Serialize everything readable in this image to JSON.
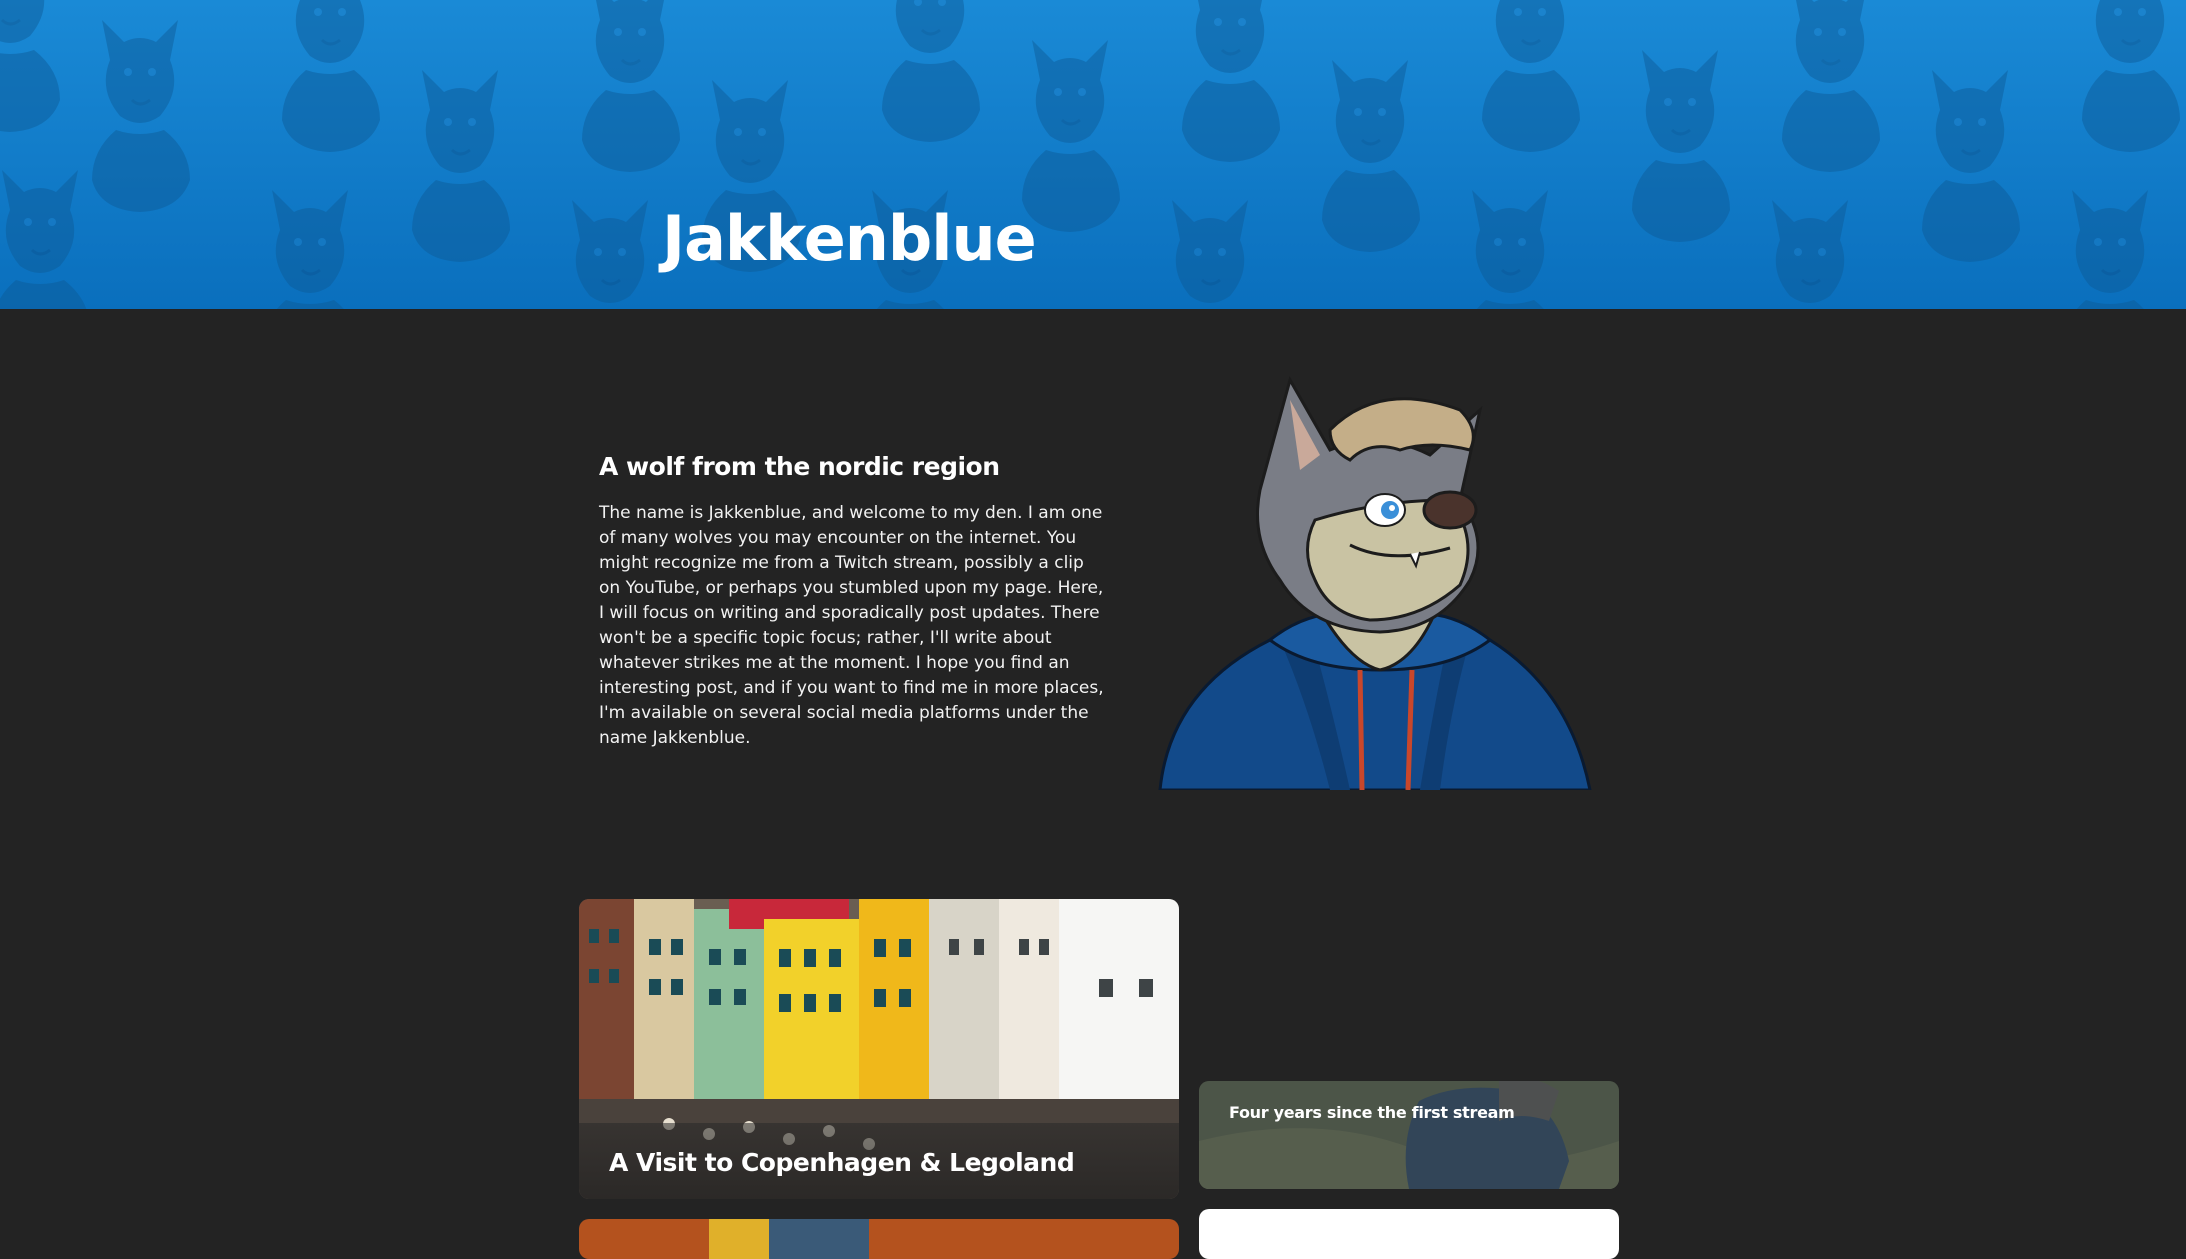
{
  "site": {
    "title": "Jakkenblue"
  },
  "intro": {
    "heading": "A wolf from the nordic region",
    "body": "The name is Jakkenblue, and welcome to my den. I am one of many wolves you may encounter on the internet. You might recognize me from a Twitch stream, possibly a clip on YouTube, or perhaps you stumbled upon my page. Here, I will focus on writing and sporadically post updates. There won't be a specific topic focus; rather, I'll write about whatever strikes me at the moment. I hope you find an interesting post, and if you want to find me in more places, I'm available on several social media platforms under the name Jakkenblue."
  },
  "posts": [
    {
      "title": "A Visit to Copenhagen & Legoland"
    },
    {
      "title": "Four years since the first stream"
    }
  ],
  "colors": {
    "banner": "#1a8ad6",
    "background": "#232323",
    "text": "#ffffff"
  }
}
